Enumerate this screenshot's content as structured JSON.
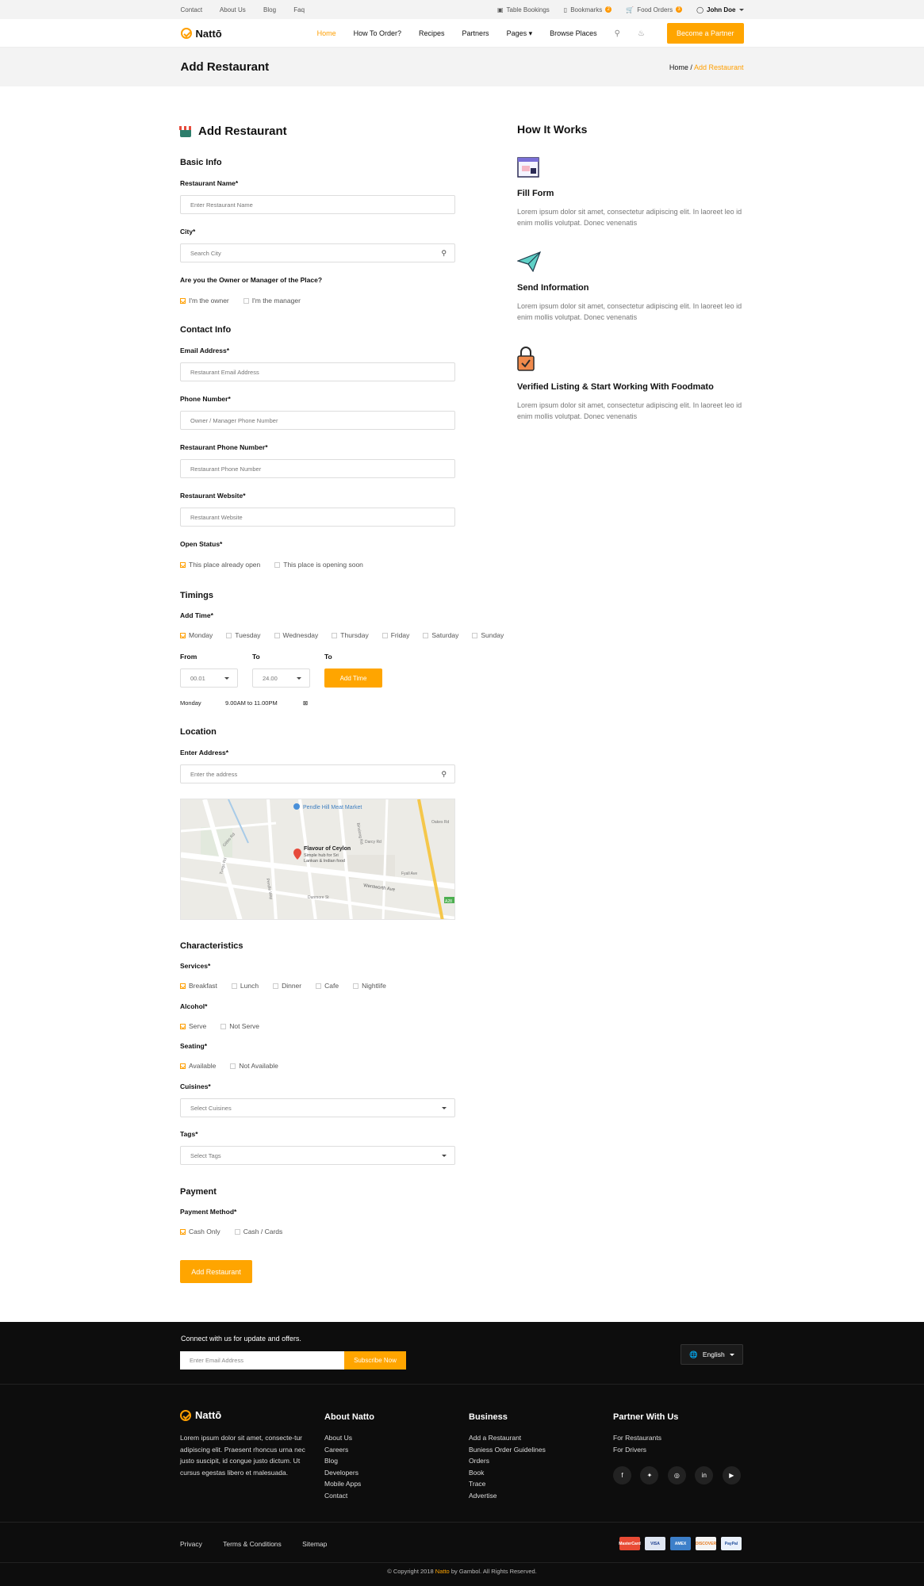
{
  "topbar": {
    "links": [
      "Contact",
      "About Us",
      "Blog",
      "Faq"
    ],
    "table_bookings": "Table Bookings",
    "bookmarks": "Bookmarks",
    "bookmarks_count": "2",
    "food_orders": "Food Orders",
    "food_orders_count": "3",
    "user": "John Doe"
  },
  "header": {
    "brand": "Nattō",
    "nav": [
      "Home",
      "How To Order?",
      "Recipes",
      "Partners",
      "Pages",
      "Browse Places"
    ],
    "partner_button": "Become a Partner"
  },
  "band": {
    "title": "Add Restaurant",
    "crumb_home": "Home /",
    "crumb_current": "Add Restaurant"
  },
  "form": {
    "title": "Add Restaurant",
    "basic_info": "Basic Info",
    "restaurant_name_label": "Restaurant Name*",
    "restaurant_name_ph": "Enter Restaurant Name",
    "city_label": "City*",
    "city_ph": "Search City",
    "owner_question": "Are you the Owner or Manager of the Place?",
    "owner_opt": "I'm the owner",
    "manager_opt": "I'm the manager",
    "contact_info": "Contact Info",
    "email_label": "Email Address*",
    "email_ph": "Restaurant Email Address",
    "phone_label": "Phone Number*",
    "phone_ph": "Owner / Manager Phone Number",
    "rphone_label": "Restaurant Phone Number*",
    "rphone_ph": "Restaurant Phone Number",
    "website_label": "Restaurant Website*",
    "website_ph": "Restaurant Website",
    "open_status_label": "Open Status*",
    "open_opt1": "This place already open",
    "open_opt2": "This place is opening soon",
    "timings": "Timings",
    "add_time_label": "Add Time*",
    "days": [
      "Monday",
      "Tuesday",
      "Wednesday",
      "Thursday",
      "Friday",
      "Saturday",
      "Sunday"
    ],
    "from_label": "From",
    "to_label": "To",
    "to2_label": "To",
    "from_value": "00.01",
    "to_value": "24.00",
    "add_time_button": "Add Time",
    "time_day": "Monday",
    "time_range": "9.00AM to 11.00PM",
    "location": "Location",
    "address_label": "Enter Address*",
    "address_ph": "Enter the address",
    "map": {
      "place": "Flavour of Ceylon",
      "place_sub1": "Simple hub for Sri",
      "place_sub2": "Lankan & Indian food",
      "poi": "Pendle Hill Meat Market",
      "streets": [
        "Wentworth Ave",
        "Dunmore St",
        "Darcy Rd",
        "Binalong Rd",
        "Pendle Way",
        "Oakes Rd",
        "Gibbs Rd",
        "Tungs Rd",
        "Fyall Ave"
      ],
      "route": "A28"
    },
    "characteristics": "Characteristics",
    "services_label": "Services*",
    "services": [
      "Breakfast",
      "Lunch",
      "Dinner",
      "Cafe",
      "Nightlife"
    ],
    "alcohol_label": "Alcohol*",
    "alcohol": [
      "Serve",
      "Not Serve"
    ],
    "seating_label": "Seating*",
    "seating": [
      "Available",
      "Not Available"
    ],
    "cuisines_label": "Cuisines*",
    "cuisines_ph": "Select Cuisines",
    "tags_label": "Tags*",
    "tags_ph": "Select Tags",
    "payment": "Payment",
    "payment_method_label": "Payment Method*",
    "payment_opts": [
      "Cash Only",
      "Cash / Cards"
    ],
    "submit": "Add Restaurant"
  },
  "how": {
    "title": "How It Works",
    "steps": [
      {
        "title": "Fill Form",
        "text": "Lorem ipsum dolor sit amet, consectetur adipiscing elit. In laoreet leo id enim mollis volutpat. Donec venenatis"
      },
      {
        "title": "Send Information",
        "text": "Lorem ipsum dolor sit amet, consectetur adipiscing elit. In laoreet leo id enim mollis volutpat. Donec venenatis"
      },
      {
        "title": "Verified Listing & Start Working With Foodmato",
        "text": "Lorem ipsum dolor sit amet, consectetur adipiscing elit. In laoreet leo id enim mollis volutpat. Donec venenatis"
      }
    ]
  },
  "footer": {
    "newsletter_title": "Connect with us for update and offers.",
    "newsletter_ph": "Enter Email Address",
    "subscribe": "Subscribe Now",
    "language": "English",
    "brand": "Nattō",
    "about_text": "Lorem ipsum dolor sit amet, consecte-tur adipiscing elit. Praesent rhoncus urna nec justo suscipit, id congue justo dictum. Ut cursus egestas libero et malesuada.",
    "col1_title": "About Natto",
    "col1": [
      "About Us",
      "Careers",
      "Blog",
      "Developers",
      "Mobile Apps",
      "Contact"
    ],
    "col2_title": "Business",
    "col2": [
      "Add a Restaurant",
      "Buniess Order Guidelines",
      "Orders",
      "Book",
      "Trace",
      "Advertise"
    ],
    "col3_title": "Partner With Us",
    "col3": [
      "For Restaurants",
      "For Drivers"
    ],
    "bottom_links": [
      "Privacy",
      "Terms & Conditions",
      "Sitemap"
    ],
    "payments": [
      "MasterCard",
      "VISA",
      "AMEX",
      "DISCOVER",
      "PayPal"
    ],
    "copy_pre": "© Copyright 2018",
    "copy_brand": "Natto",
    "copy_post": "by Gambol. All Rights Reserved."
  },
  "colors": {
    "accent": "#ffa500",
    "footer_bg": "#0d0d0d"
  }
}
